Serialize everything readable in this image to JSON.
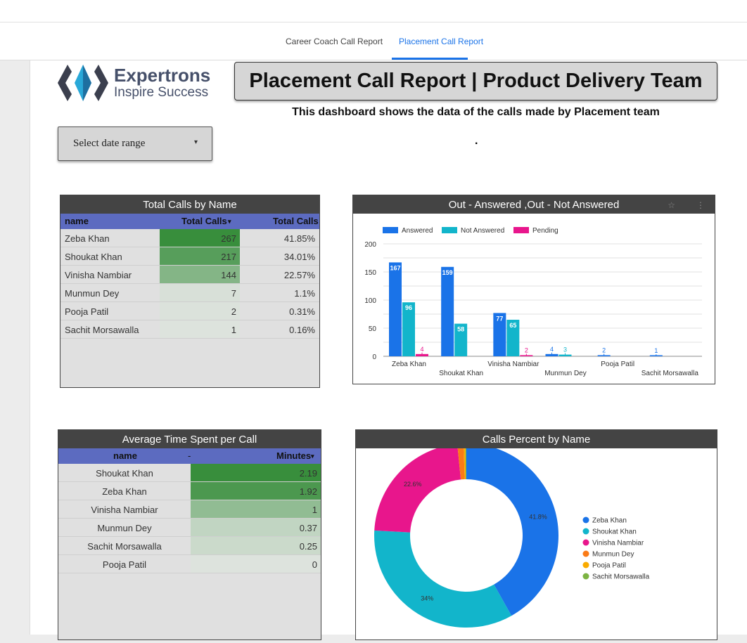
{
  "tabs": [
    {
      "label": "Career Coach Call Report",
      "active": false
    },
    {
      "label": "Placement Call Report",
      "active": true
    }
  ],
  "logo": {
    "name": "Expertrons",
    "tagline": "Inspire Success"
  },
  "header": {
    "title": "Placement Call Report | Product Delivery Team",
    "subtitle": "This dashboard shows the data of the calls made by Placement team",
    "dot": "."
  },
  "date_range": {
    "label": "Select date range",
    "arrow": "▾"
  },
  "total_calls": {
    "title": "Total Calls by Name",
    "headers": {
      "name": "name",
      "total": "Total Calls",
      "sort": "▾",
      "pct": "Total Calls"
    },
    "rows": [
      {
        "name": "Zeba Khan",
        "value": "267",
        "pct": "41.85%",
        "level": 1.0
      },
      {
        "name": "Shoukat Khan",
        "value": "217",
        "pct": "34.01%",
        "level": 0.81
      },
      {
        "name": "Vinisha Nambiar",
        "value": "144",
        "pct": "22.57%",
        "level": 0.54
      },
      {
        "name": "Munmun Dey",
        "value": "7",
        "pct": "1.1%",
        "level": 0.03
      },
      {
        "name": "Pooja Patil",
        "value": "2",
        "pct": "0.31%",
        "level": 0.01
      },
      {
        "name": "Sachit Morsawalla",
        "value": "1",
        "pct": "0.16%",
        "level": 0.0
      }
    ]
  },
  "avg_time": {
    "title": "Average Time Spent per Call",
    "headers": {
      "name": "name",
      "minutes": "Minutes",
      "sort": "▾",
      "dash": "-"
    },
    "rows": [
      {
        "name": "Shoukat Khan",
        "value": "2.19",
        "level": 1.0
      },
      {
        "name": "Zeba Khan",
        "value": "1.92",
        "level": 0.88
      },
      {
        "name": "Vinisha Nambiar",
        "value": "1",
        "level": 0.46
      },
      {
        "name": "Munmun Dey",
        "value": "0.37",
        "level": 0.17
      },
      {
        "name": "Sachit Morsawalla",
        "value": "0.25",
        "level": 0.11
      },
      {
        "name": "Pooja Patil",
        "value": "0",
        "level": 0.0
      }
    ]
  },
  "colors": {
    "answered": "#1a73e8",
    "not_answered": "#12b5cb",
    "pending": "#e8168c",
    "accent": "#1a73e8",
    "heat_high": "#388e3c",
    "heat_low": "#dde3dd"
  },
  "icons": {
    "star": "☆",
    "more": "⋮"
  },
  "chart_data": [
    {
      "type": "bar",
      "title": "Out - Answered ,Out - Not Answered",
      "categories": [
        "Zeba Khan",
        "Shoukat Khan",
        "Vinisha Nambiar",
        "Munmun Dey",
        "Pooja Patil",
        "Sachit Morsawalla"
      ],
      "series": [
        {
          "name": "Answered",
          "values": [
            167,
            159,
            77,
            4,
            2,
            1
          ]
        },
        {
          "name": "Not Answered",
          "values": [
            96,
            58,
            65,
            3,
            0,
            0
          ]
        },
        {
          "name": "Pending",
          "values": [
            4,
            0,
            2,
            0,
            0,
            0
          ]
        }
      ],
      "ylim": [
        0,
        200
      ],
      "yticks": [
        "0",
        "50",
        "100",
        "150",
        "200"
      ],
      "legend": "top-left",
      "grid": true
    },
    {
      "type": "pie",
      "title": "Calls Percent  by Name",
      "labels": [
        "Zeba Khan",
        "Shoukat Khan",
        "Vinisha Nambiar",
        "Munmun Dey",
        "Pooja Patil",
        "Sachit Morsawalla"
      ],
      "values": [
        41.85,
        34.01,
        22.57,
        1.1,
        0.31,
        0.16
      ],
      "slice_labels": [
        "41.8%",
        "34%",
        "22.6%",
        "",
        "",
        ""
      ],
      "colors": [
        "#1a73e8",
        "#12b5cb",
        "#e8168c",
        "#fa7b17",
        "#f9ab00",
        "#7cb342"
      ],
      "legend": "right",
      "donut": true
    }
  ]
}
